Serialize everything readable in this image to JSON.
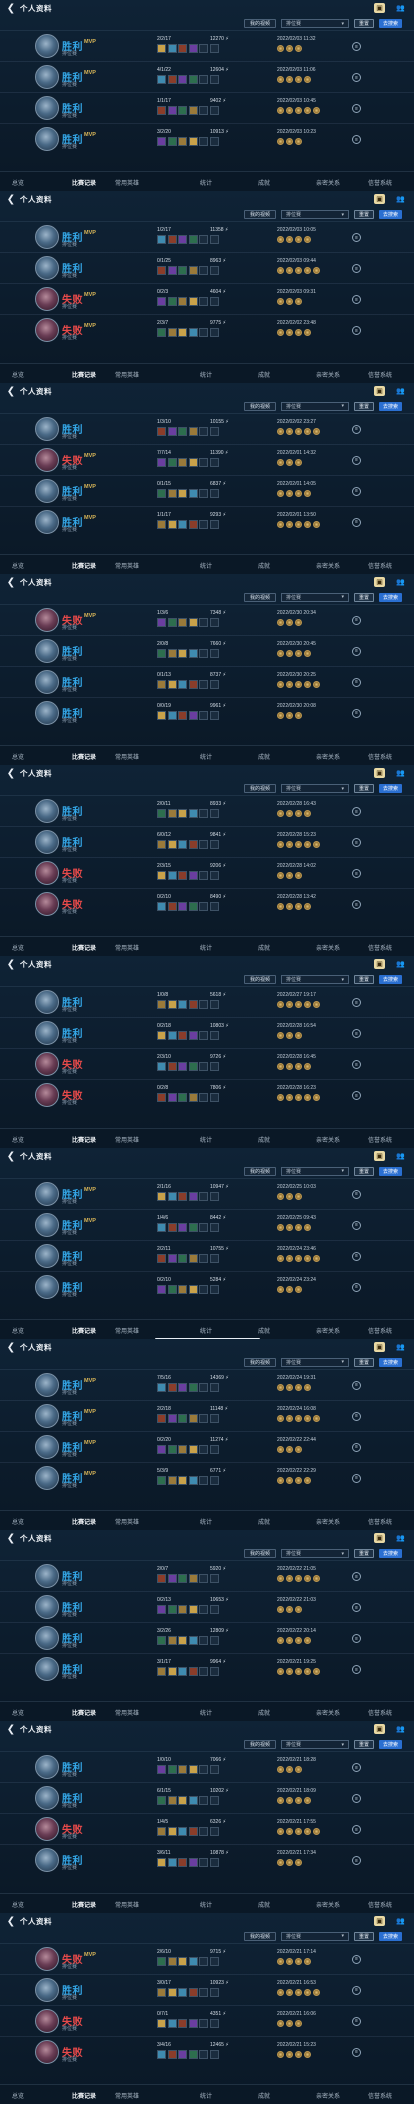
{
  "header": {
    "title": "个人资料"
  },
  "filters": {
    "view_button": "我的视频",
    "select_value": "排位赛",
    "reset": "重置",
    "apply": "去搜索"
  },
  "tabs": [
    "总览",
    "比赛记录",
    "常用英雄",
    "统计",
    "成就",
    "亲密关系",
    "信誉系统"
  ],
  "mode": "排位赛",
  "mvp_label": "MVP",
  "blocks": [
    {
      "rows": [
        {
          "result": "胜利",
          "mvp": true,
          "kda": "2/2/17",
          "score": "12270",
          "time": "2022/02/03 11:32"
        },
        {
          "result": "胜利",
          "mvp": true,
          "kda": "4/1/22",
          "score": "12604",
          "time": "2022/02/03 11:06"
        },
        {
          "result": "胜利",
          "mvp": false,
          "kda": "1/1/17",
          "score": "9402",
          "time": "2022/02/03 10:45"
        },
        {
          "result": "胜利",
          "mvp": true,
          "kda": "3/2/20",
          "score": "10913",
          "time": "2022/02/03 10:23"
        }
      ]
    },
    {
      "rows": [
        {
          "result": "胜利",
          "mvp": true,
          "kda": "1/2/17",
          "score": "11358",
          "time": "2022/02/03 10:05"
        },
        {
          "result": "胜利",
          "mvp": false,
          "kda": "0/1/25",
          "score": "8963",
          "time": "2022/02/03 09:44"
        },
        {
          "result": "失败",
          "mvp": true,
          "kda": "0/2/3",
          "score": "4604",
          "time": "2022/02/03 09:31"
        },
        {
          "result": "失败",
          "mvp": true,
          "kda": "2/3/7",
          "score": "9775",
          "time": "2022/02/02 23:48"
        }
      ]
    },
    {
      "rows": [
        {
          "result": "胜利",
          "mvp": false,
          "kda": "1/3/10",
          "score": "10155",
          "time": "2022/02/02 23:27"
        },
        {
          "result": "失败",
          "mvp": true,
          "kda": "7/7/14",
          "score": "11390",
          "time": "2022/02/01 14:32"
        },
        {
          "result": "胜利",
          "mvp": true,
          "kda": "0/1/15",
          "score": "6837",
          "time": "2022/02/01 14:05"
        },
        {
          "result": "胜利",
          "mvp": true,
          "kda": "1/1/17",
          "score": "9293",
          "time": "2022/02/01 13:50"
        }
      ]
    },
    {
      "rows": [
        {
          "result": "失败",
          "mvp": true,
          "kda": "1/3/6",
          "score": "7348",
          "time": "2022/02/30 20:34"
        },
        {
          "result": "胜利",
          "mvp": false,
          "kda": "2/0/8",
          "score": "7660",
          "time": "2022/02/30 20:45"
        },
        {
          "result": "胜利",
          "mvp": false,
          "kda": "0/1/13",
          "score": "8737",
          "time": "2022/02/30 20:25"
        },
        {
          "result": "胜利",
          "mvp": false,
          "kda": "0/0/19",
          "score": "9961",
          "time": "2022/02/30 20:08"
        }
      ]
    },
    {
      "rows": [
        {
          "result": "胜利",
          "mvp": false,
          "kda": "2/0/11",
          "score": "8933",
          "time": "2022/02/28 16:43"
        },
        {
          "result": "胜利",
          "mvp": false,
          "kda": "6/0/12",
          "score": "9841",
          "time": "2022/02/28 15:23"
        },
        {
          "result": "失败",
          "mvp": false,
          "kda": "2/3/15",
          "score": "9206",
          "time": "2022/02/28 14:02"
        },
        {
          "result": "失败",
          "mvp": false,
          "kda": "0/2/10",
          "score": "8490",
          "time": "2022/02/28 13:42"
        }
      ]
    },
    {
      "rows": [
        {
          "result": "胜利",
          "mvp": false,
          "kda": "1/0/8",
          "score": "5618",
          "time": "2022/02/27 19:17"
        },
        {
          "result": "胜利",
          "mvp": false,
          "kda": "0/2/18",
          "score": "10803",
          "time": "2022/02/28 16:54"
        },
        {
          "result": "失败",
          "mvp": false,
          "kda": "2/3/10",
          "score": "9726",
          "time": "2022/02/28 16:45"
        },
        {
          "result": "失败",
          "mvp": false,
          "kda": "0/2/8",
          "score": "7806",
          "time": "2022/02/28 16:23"
        }
      ]
    },
    {
      "rows": [
        {
          "result": "胜利",
          "mvp": true,
          "kda": "2/1/16",
          "score": "10947",
          "time": "2022/02/25 10:03"
        },
        {
          "result": "胜利",
          "mvp": true,
          "kda": "1/4/6",
          "score": "8442",
          "time": "2022/02/25 09:43"
        },
        {
          "result": "胜利",
          "mvp": false,
          "kda": "2/2/11",
          "score": "10755",
          "time": "2022/02/24 23:46"
        },
        {
          "result": "胜利",
          "mvp": false,
          "kda": "0/2/10",
          "score": "5284",
          "time": "2022/02/24 23:24"
        }
      ]
    },
    {
      "rows": [
        {
          "result": "胜利",
          "mvp": true,
          "kda": "7/5/16",
          "score": "14369",
          "time": "2022/02/24 19:31"
        },
        {
          "result": "胜利",
          "mvp": true,
          "kda": "2/2/18",
          "score": "11148",
          "time": "2022/02/24 16:08"
        },
        {
          "result": "胜利",
          "mvp": true,
          "kda": "0/2/20",
          "score": "11274",
          "time": "2022/02/22 22:44"
        },
        {
          "result": "胜利",
          "mvp": true,
          "kda": "5/3/9",
          "score": "6771",
          "time": "2022/02/22 22:29"
        }
      ]
    },
    {
      "rows": [
        {
          "result": "胜利",
          "mvp": false,
          "kda": "2/0/7",
          "score": "5920",
          "time": "2022/02/22 21:05"
        },
        {
          "result": "胜利",
          "mvp": false,
          "kda": "0/2/13",
          "score": "10653",
          "time": "2022/02/22 21:03"
        },
        {
          "result": "胜利",
          "mvp": false,
          "kda": "3/2/26",
          "score": "12809",
          "time": "2022/02/22 20:14"
        },
        {
          "result": "胜利",
          "mvp": false,
          "kda": "3/1/17",
          "score": "9964",
          "time": "2022/02/21 19:25"
        }
      ]
    },
    {
      "rows": [
        {
          "result": "胜利",
          "mvp": false,
          "kda": "1/0/10",
          "score": "7066",
          "time": "2022/02/21 18:28"
        },
        {
          "result": "胜利",
          "mvp": false,
          "kda": "6/1/15",
          "score": "10202",
          "time": "2022/02/21 18:09"
        },
        {
          "result": "失败",
          "mvp": false,
          "kda": "1/4/5",
          "score": "6326",
          "time": "2022/02/21 17:55"
        },
        {
          "result": "胜利",
          "mvp": false,
          "kda": "3/6/11",
          "score": "10878",
          "time": "2022/02/21 17:34"
        }
      ]
    },
    {
      "rows": [
        {
          "result": "失败",
          "mvp": true,
          "kda": "2/6/10",
          "score": "9715",
          "time": "2022/02/21 17:14"
        },
        {
          "result": "胜利",
          "mvp": false,
          "kda": "3/0/17",
          "score": "10923",
          "time": "2022/02/21 16:53"
        },
        {
          "result": "失败",
          "mvp": false,
          "kda": "0/7/1",
          "score": "4351",
          "time": "2022/02/21 16:06"
        },
        {
          "result": "失败",
          "mvp": false,
          "kda": "3/4/16",
          "score": "12465",
          "time": "2022/02/21 15:23"
        }
      ]
    }
  ]
}
